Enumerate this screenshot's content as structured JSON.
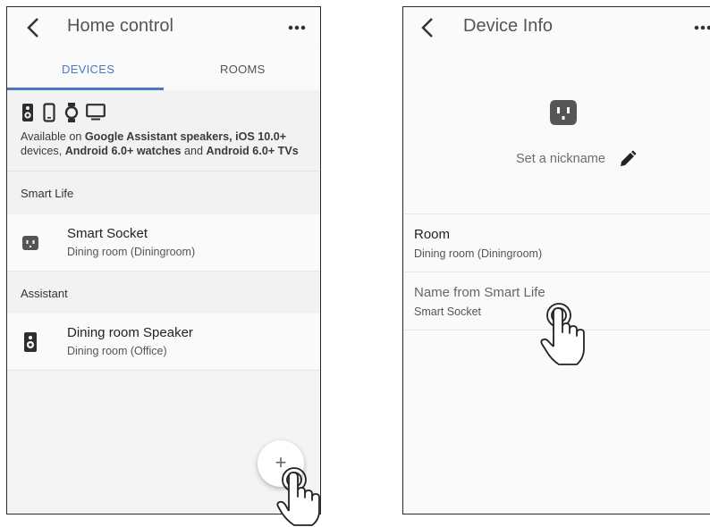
{
  "left_screen": {
    "app_bar": {
      "title": "Home control",
      "back_icon": "chevron-left-icon",
      "menu_icon": "more-horiz-icon"
    },
    "tabs": [
      {
        "label": "DEVICES",
        "active": true
      },
      {
        "label": "ROOMS",
        "active": false
      }
    ],
    "compat_banner": {
      "icons": [
        "speaker-icon",
        "phone-icon",
        "watch-icon",
        "tv-icon"
      ],
      "text_pre": "Available on ",
      "text_bold_1": "Google Assistant speakers, iOS 10.0+",
      "text_mid_1": "devices, ",
      "text_bold_2": "Android 6.0+ watches",
      "text_mid_2": " and ",
      "text_bold_3": "Android 6.0+ TVs"
    },
    "sections": [
      {
        "header": "Smart Life",
        "device": {
          "name": "Smart Socket",
          "room": "Dining room (Diningroom)",
          "icon": "outlet-icon"
        }
      },
      {
        "header": "Assistant",
        "device": {
          "name": "Dining room Speaker",
          "room": "Dining room (Office)",
          "icon": "speaker-icon"
        }
      }
    ],
    "fab": {
      "label": "+",
      "icon": "add-icon"
    }
  },
  "right_screen": {
    "app_bar": {
      "title": "Device Info",
      "back_icon": "chevron-left-icon",
      "menu_icon": "more-horiz-icon"
    },
    "device_icon": "outlet-icon",
    "nickname_placeholder": "Set a nickname",
    "edit_icon": "pencil-icon",
    "rows": [
      {
        "title": "Room",
        "value": "Dining room (Diningroom)"
      },
      {
        "title": "Name from Smart Life",
        "value": "Smart Socket"
      }
    ]
  },
  "colors": {
    "accent": "#4a78c4",
    "icon_dark": "#3b3b3b",
    "outlet_grey": "#555555"
  }
}
